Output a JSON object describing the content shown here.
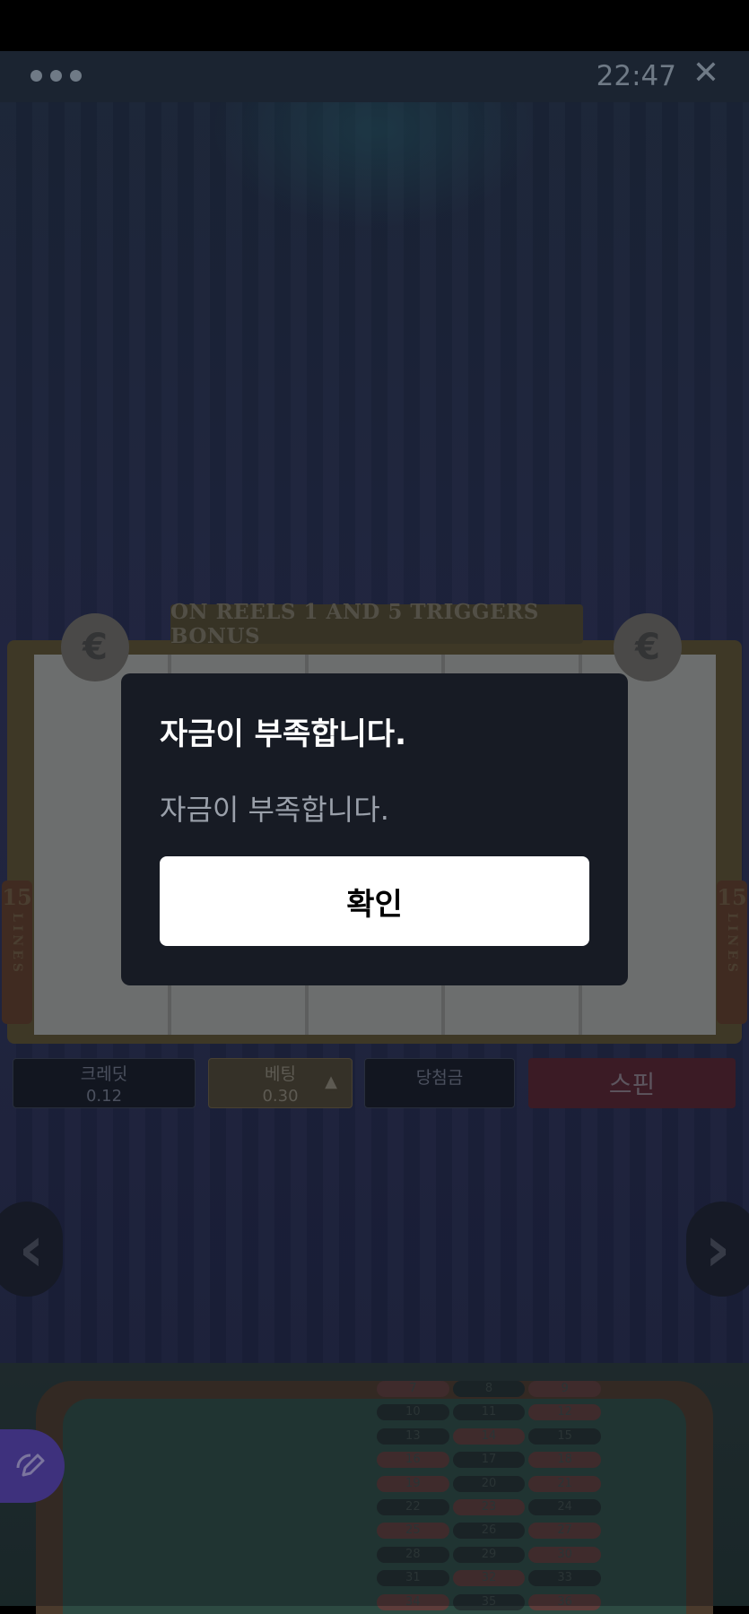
{
  "topbar": {
    "time": "22:47",
    "close_label": "✕"
  },
  "slot": {
    "banner_text": "ON REELS 1 AND 5 TRIGGERS BONUS",
    "coin_symbol": "€",
    "lines_number": "15",
    "lines_label": "LINES"
  },
  "controls": {
    "credit_label": "크레딧",
    "credit_value": "0.12",
    "bet_label": "베팅",
    "bet_value": "0.30",
    "bet_arrow": "▲",
    "win_label": "당첨금",
    "spin_label": "스핀"
  },
  "nav": {
    "prev": "‹",
    "next": "›"
  },
  "roulette": {
    "numbers": [
      "7",
      "8",
      "9",
      "10",
      "11",
      "12",
      "13",
      "14",
      "15",
      "16",
      "17",
      "18",
      "19",
      "20",
      "21",
      "22",
      "23",
      "24",
      "25",
      "26",
      "27",
      "28",
      "29",
      "30",
      "31",
      "32",
      "33",
      "34",
      "35",
      "36"
    ]
  },
  "dialog": {
    "title": "자금이 부족합니다.",
    "message": "자금이 부족합니다.",
    "ok_label": "확인"
  },
  "colors": {
    "accent_fab": "#5b45b5",
    "dialog_bg": "#171b24",
    "button_bg": "#ffffff"
  }
}
